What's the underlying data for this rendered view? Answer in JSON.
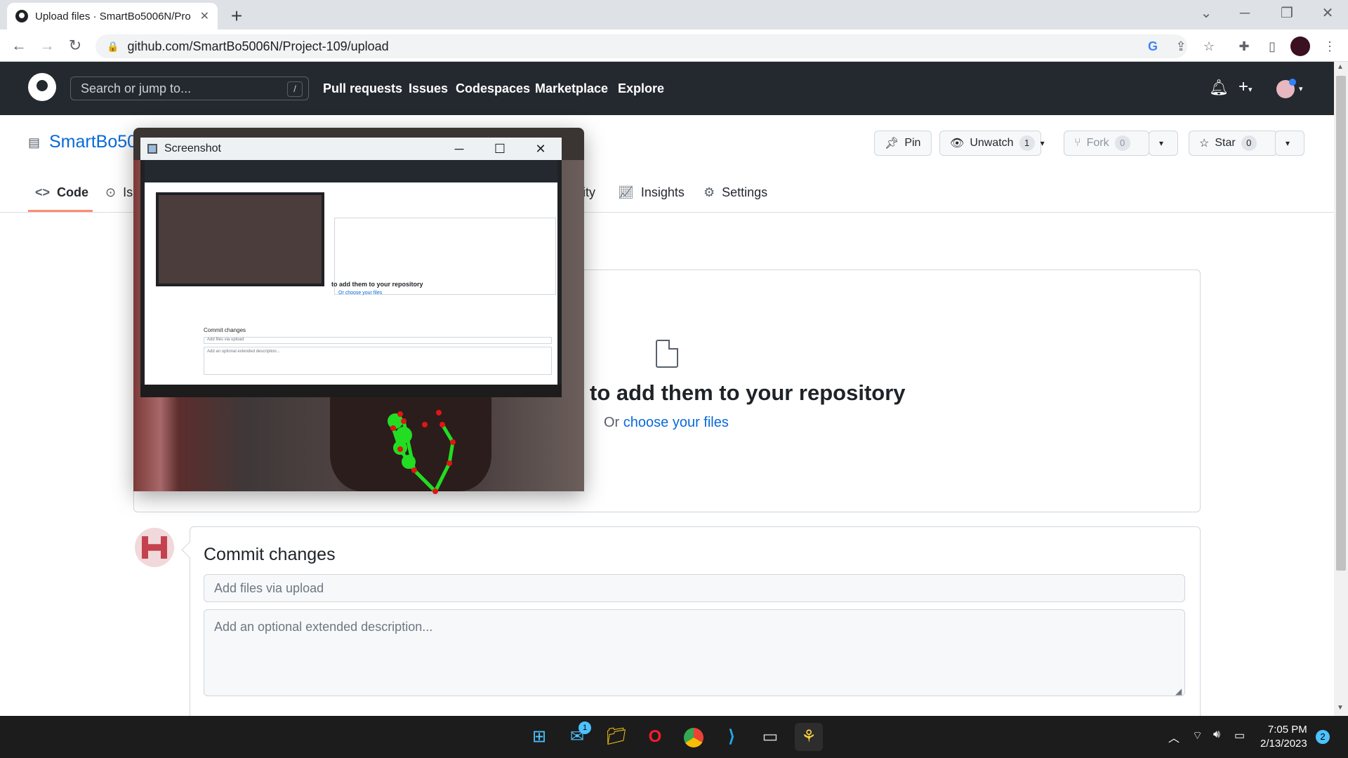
{
  "browser": {
    "tab_title": "Upload files · SmartBo5006N/Pro",
    "url": "github.com/SmartBo5006N/Project-109/upload"
  },
  "github": {
    "search_placeholder": "Search or jump to...",
    "search_shortcut": "/",
    "nav": [
      "Pull requests",
      "Issues",
      "Codespaces",
      "Marketplace",
      "Explore"
    ]
  },
  "repo": {
    "name": "SmartBo50",
    "pin_label": "Pin",
    "unwatch_label": "Unwatch",
    "unwatch_count": "1",
    "fork_label": "Fork",
    "fork_count": "0",
    "star_label": "Star",
    "star_count": "0",
    "tabs": {
      "code": "Code",
      "issues_partial": "Is",
      "security_partial": "ity",
      "insights": "Insights",
      "settings": "Settings"
    }
  },
  "upload": {
    "drag_text": "to add them to your repository",
    "or_text": "Or",
    "choose_link": "choose your files"
  },
  "commit": {
    "title": "Commit changes",
    "message_placeholder": "Add files via upload",
    "description_placeholder": "Add an optional extended description..."
  },
  "screenshot_window": {
    "title": "Screenshot",
    "inner_drag_text": "to add them to your repository",
    "inner_choose": "Or choose your files",
    "inner_commit_title": "Commit changes",
    "inner_commit_msg": "Add files via upload",
    "inner_commit_desc": "Add an optional extended description..."
  },
  "taskbar": {
    "time": "7:05 PM",
    "date": "2/13/2023",
    "mail_badge": "1",
    "notification_count": "2"
  },
  "colors": {
    "github_header": "#24292f",
    "link_blue": "#0969da",
    "tab_underline": "#fd8c73",
    "landmark_green": "#22dd22",
    "landmark_red": "#e01515"
  }
}
